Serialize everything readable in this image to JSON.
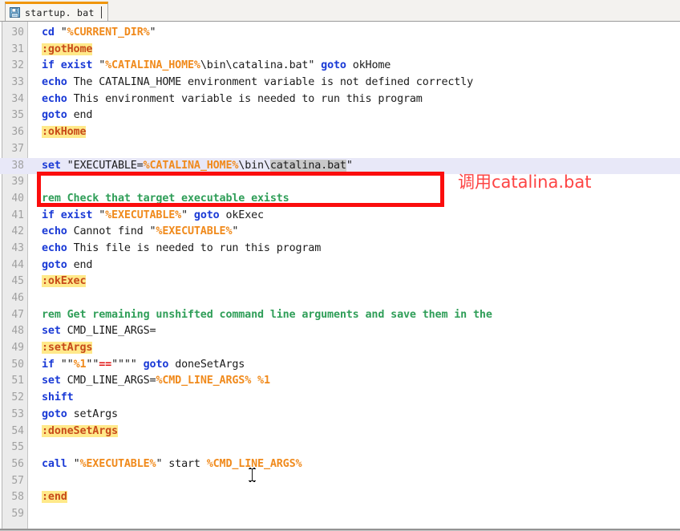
{
  "window": {
    "tab": {
      "label": "startup. bat",
      "icon": "save-floppy-icon",
      "accent_color": "#f09609"
    }
  },
  "annotation": {
    "text": "调用catalina.bat",
    "color": "#fd4444",
    "box_color": "#fb0d0d"
  },
  "editor": {
    "first_line_number": 30,
    "current_line": 38,
    "selection_text": "catalina.bat",
    "colors": {
      "keyword": "#1a3ad6",
      "variable": "#f08a1c",
      "comment": "#2f9e58",
      "label": "#c74b1a",
      "label_background": "#ffe98a",
      "operator": "#e01010",
      "plain": "#1b1b1b",
      "selection_background": "#c9c9c9",
      "current_line_background": "#e8e8f8",
      "gutter_background": "#ebebeb",
      "line_number": "#a0a0a0"
    },
    "lines": [
      {
        "n": 30,
        "tokens": [
          {
            "t": "cd ",
            "c": "kw"
          },
          {
            "t": "\"",
            "c": "plain"
          },
          {
            "t": "%CURRENT_DIR%",
            "c": "var"
          },
          {
            "t": "\"",
            "c": "plain"
          }
        ]
      },
      {
        "n": 31,
        "tokens": [
          {
            "t": ":gotHome",
            "c": "lbl"
          }
        ]
      },
      {
        "n": 32,
        "tokens": [
          {
            "t": "if exist ",
            "c": "kw"
          },
          {
            "t": "\"",
            "c": "plain"
          },
          {
            "t": "%CATALINA_HOME%",
            "c": "var"
          },
          {
            "t": "\\bin\\catalina.bat\" ",
            "c": "plain"
          },
          {
            "t": "goto ",
            "c": "kw"
          },
          {
            "t": "okHome",
            "c": "plain"
          }
        ]
      },
      {
        "n": 33,
        "tokens": [
          {
            "t": "echo ",
            "c": "kw"
          },
          {
            "t": "The CATALINA_HOME environment variable is not defined correctly",
            "c": "plain"
          }
        ]
      },
      {
        "n": 34,
        "tokens": [
          {
            "t": "echo ",
            "c": "kw"
          },
          {
            "t": "This environment variable is needed to run this program",
            "c": "plain"
          }
        ]
      },
      {
        "n": 35,
        "tokens": [
          {
            "t": "goto ",
            "c": "kw"
          },
          {
            "t": "end",
            "c": "plain"
          }
        ]
      },
      {
        "n": 36,
        "tokens": [
          {
            "t": ":okHome",
            "c": "lbl"
          }
        ]
      },
      {
        "n": 37,
        "tokens": []
      },
      {
        "n": 38,
        "current": true,
        "tokens": [
          {
            "t": "set ",
            "c": "kw"
          },
          {
            "t": "\"EXECUTABLE=",
            "c": "plain"
          },
          {
            "t": "%CATALINA_HOME%",
            "c": "var"
          },
          {
            "t": "\\bin\\",
            "c": "plain"
          },
          {
            "t": "catalina.bat",
            "c": "sel"
          },
          {
            "t": "\"",
            "c": "plain"
          }
        ]
      },
      {
        "n": 39,
        "tokens": []
      },
      {
        "n": 40,
        "tokens": [
          {
            "t": "rem Check that target executable exists",
            "c": "cmt"
          }
        ]
      },
      {
        "n": 41,
        "tokens": [
          {
            "t": "if exist ",
            "c": "kw"
          },
          {
            "t": "\"",
            "c": "plain"
          },
          {
            "t": "%EXECUTABLE%",
            "c": "var"
          },
          {
            "t": "\" ",
            "c": "plain"
          },
          {
            "t": "goto ",
            "c": "kw"
          },
          {
            "t": "okExec",
            "c": "plain"
          }
        ]
      },
      {
        "n": 42,
        "tokens": [
          {
            "t": "echo ",
            "c": "kw"
          },
          {
            "t": "Cannot find \"",
            "c": "plain"
          },
          {
            "t": "%EXECUTABLE%",
            "c": "var"
          },
          {
            "t": "\"",
            "c": "plain"
          }
        ]
      },
      {
        "n": 43,
        "tokens": [
          {
            "t": "echo ",
            "c": "kw"
          },
          {
            "t": "This file is needed to run this program",
            "c": "plain"
          }
        ]
      },
      {
        "n": 44,
        "tokens": [
          {
            "t": "goto ",
            "c": "kw"
          },
          {
            "t": "end",
            "c": "plain"
          }
        ]
      },
      {
        "n": 45,
        "tokens": [
          {
            "t": ":okExec",
            "c": "lbl"
          }
        ]
      },
      {
        "n": 46,
        "tokens": []
      },
      {
        "n": 47,
        "tokens": [
          {
            "t": "rem Get remaining unshifted command line arguments and save them in the",
            "c": "cmt"
          }
        ]
      },
      {
        "n": 48,
        "tokens": [
          {
            "t": "set ",
            "c": "kw"
          },
          {
            "t": "CMD_LINE_ARGS=",
            "c": "plain"
          }
        ]
      },
      {
        "n": 49,
        "tokens": [
          {
            "t": ":setArgs",
            "c": "lbl"
          }
        ]
      },
      {
        "n": 50,
        "tokens": [
          {
            "t": "if ",
            "c": "kw"
          },
          {
            "t": "\"\"",
            "c": "plain"
          },
          {
            "t": "%1",
            "c": "var"
          },
          {
            "t": "\"\"",
            "c": "plain"
          },
          {
            "t": "==",
            "c": "op"
          },
          {
            "t": "\"\"\"\" ",
            "c": "plain"
          },
          {
            "t": "goto ",
            "c": "kw"
          },
          {
            "t": "doneSetArgs",
            "c": "plain"
          }
        ]
      },
      {
        "n": 51,
        "tokens": [
          {
            "t": "set ",
            "c": "kw"
          },
          {
            "t": "CMD_LINE_ARGS=",
            "c": "plain"
          },
          {
            "t": "%CMD_LINE_ARGS%",
            "c": "var"
          },
          {
            "t": " ",
            "c": "plain"
          },
          {
            "t": "%1",
            "c": "var"
          }
        ]
      },
      {
        "n": 52,
        "tokens": [
          {
            "t": "shift",
            "c": "kw"
          }
        ]
      },
      {
        "n": 53,
        "tokens": [
          {
            "t": "goto ",
            "c": "kw"
          },
          {
            "t": "setArgs",
            "c": "plain"
          }
        ]
      },
      {
        "n": 54,
        "tokens": [
          {
            "t": ":doneSetArgs",
            "c": "lbl"
          }
        ]
      },
      {
        "n": 55,
        "tokens": []
      },
      {
        "n": 56,
        "tokens": [
          {
            "t": "call ",
            "c": "kw"
          },
          {
            "t": "\"",
            "c": "plain"
          },
          {
            "t": "%EXECUTABLE%",
            "c": "var"
          },
          {
            "t": "\" start ",
            "c": "plain"
          },
          {
            "t": "%CMD_LINE_ARGS%",
            "c": "var"
          }
        ]
      },
      {
        "n": 57,
        "tokens": []
      },
      {
        "n": 58,
        "tokens": [
          {
            "t": ":end",
            "c": "lbl"
          }
        ]
      },
      {
        "n": 59,
        "tokens": []
      }
    ]
  }
}
